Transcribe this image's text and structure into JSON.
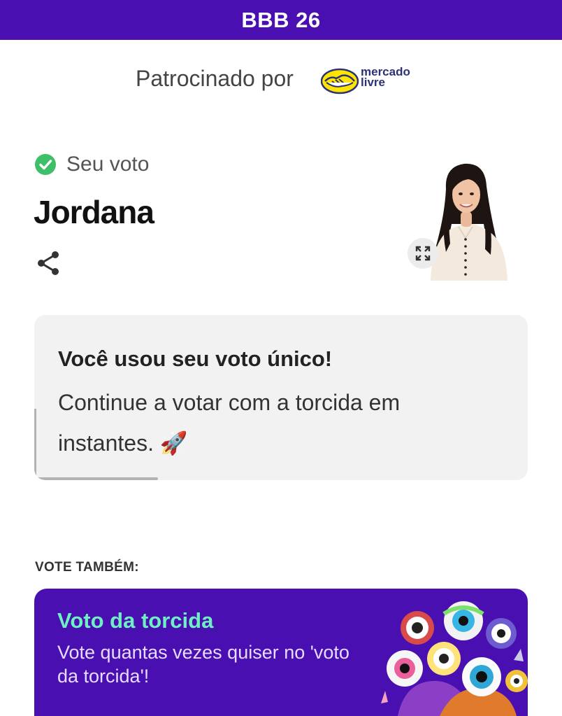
{
  "header": {
    "title": "BBB 26"
  },
  "sponsor": {
    "label": "Patrocinado por",
    "brand_line1": "mercado",
    "brand_line2": "livre"
  },
  "vote": {
    "status_label": "Seu voto",
    "candidate": "Jordana"
  },
  "notice": {
    "title": "Você usou seu voto único!",
    "body": "Continue a votar com a torcida em instantes. 🚀",
    "progress": 0.25
  },
  "also_vote": {
    "label": "VOTE TAMBÉM:",
    "card_title": "Voto da torcida",
    "card_text": "Vote quantas vezes quiser no 'voto da torcida'!"
  },
  "colors": {
    "brand_purple": "#4a0fb0",
    "success_green": "#3fbf6a",
    "promo_title": "#6ff0c3"
  },
  "icons": {
    "status": "check-circle-icon",
    "share": "share-icon",
    "expand": "expand-icon"
  }
}
